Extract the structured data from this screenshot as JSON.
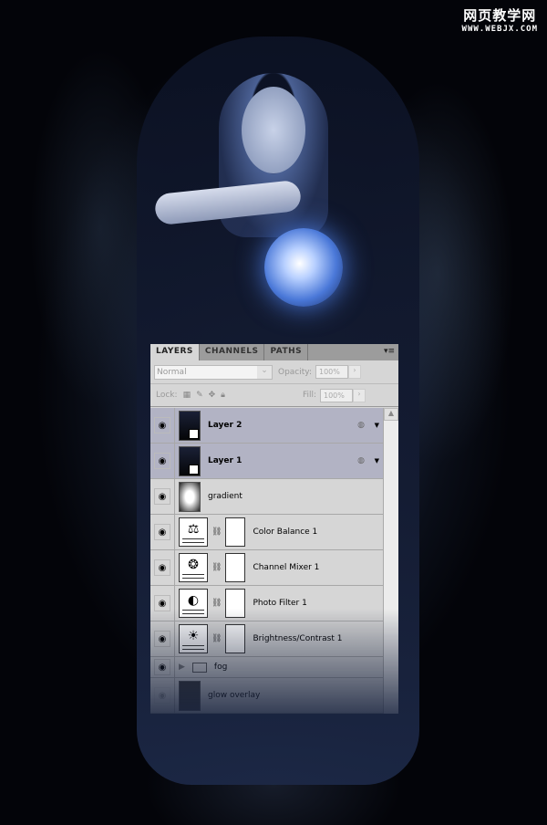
{
  "watermark": {
    "line1": "网页教学网",
    "line2": "WWW.WEBJX.COM"
  },
  "panel": {
    "tabs": [
      {
        "label": "LAYERS",
        "active": true
      },
      {
        "label": "CHANNELS"
      },
      {
        "label": "PATHS"
      }
    ],
    "menu_icon": "panel-menu-icon",
    "blend_mode": "Normal",
    "opacity_label": "Opacity:",
    "opacity": "100%",
    "lock_label": "Lock:",
    "fill_label": "Fill:",
    "fill": "100%",
    "layers": [
      {
        "name": "Layer 2",
        "selected": true,
        "type": "smart",
        "visible": true
      },
      {
        "name": "Layer 1",
        "selected": true,
        "type": "smart",
        "visible": true
      },
      {
        "name": "gradient",
        "type": "pixel",
        "visible": true
      },
      {
        "name": "Color Balance 1",
        "type": "adjustment",
        "icon": "scale-icon",
        "visible": true
      },
      {
        "name": "Channel Mixer 1",
        "type": "adjustment",
        "icon": "circles-icon",
        "visible": true
      },
      {
        "name": "Photo Filter 1",
        "type": "adjustment",
        "icon": "camera-icon",
        "visible": true
      },
      {
        "name": "Brightness/Contrast 1",
        "type": "adjustment",
        "icon": "sun-icon",
        "visible": true
      },
      {
        "name": "fog",
        "type": "group",
        "visible": true
      },
      {
        "name": "glow overlay",
        "type": "pixel",
        "visible": false
      }
    ]
  }
}
